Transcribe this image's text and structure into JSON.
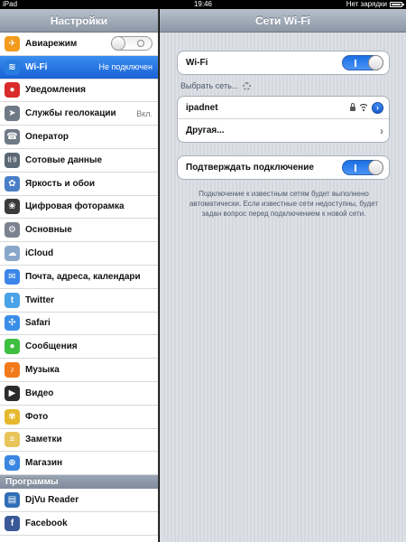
{
  "status": {
    "device": "iPad",
    "time": "19:46",
    "charging": "Нет зарядки",
    "battery_level": 0.85
  },
  "sidebar": {
    "title": "Настройки",
    "items": [
      {
        "label": "Авиарежим",
        "icon": "airplane-icon",
        "color": "#f29b1d",
        "glyph": "✈",
        "value": "",
        "toggle": true
      },
      {
        "label": "Wi-Fi",
        "icon": "wifi-icon",
        "color": "#2a7de0",
        "glyph": "≋",
        "value": "Не подключен",
        "selected": true
      },
      {
        "label": "Уведомления",
        "icon": "notifications-icon",
        "color": "#d92b2b",
        "glyph": "●",
        "value": ""
      },
      {
        "label": "Службы геолокации",
        "icon": "location-icon",
        "color": "#707a86",
        "glyph": "➤",
        "value": "Вкл."
      },
      {
        "label": "Оператор",
        "icon": "carrier-icon",
        "color": "#707a86",
        "glyph": "☎",
        "value": ""
      },
      {
        "label": "Сотовые данные",
        "icon": "cellular-icon",
        "color": "#5c6875",
        "glyph": "((·))",
        "value": ""
      },
      {
        "label": "Яркость и обои",
        "icon": "brightness-icon",
        "color": "#4a7fc7",
        "glyph": "✿",
        "value": ""
      },
      {
        "label": "Цифровая фоторамка",
        "icon": "picture-frame-icon",
        "color": "#3b3b3b",
        "glyph": "❀",
        "value": ""
      },
      {
        "label": "Основные",
        "icon": "gear-icon",
        "color": "#7b8390",
        "glyph": "⚙",
        "value": ""
      },
      {
        "label": "iCloud",
        "icon": "icloud-icon",
        "color": "#8aa6c9",
        "glyph": "☁",
        "value": ""
      },
      {
        "label": "Почта, адреса, календари",
        "icon": "mail-icon",
        "color": "#3b86e8",
        "glyph": "✉",
        "value": ""
      },
      {
        "label": "Twitter",
        "icon": "twitter-icon",
        "color": "#4aa3e6",
        "glyph": "t",
        "value": ""
      },
      {
        "label": "Safari",
        "icon": "safari-icon",
        "color": "#3a8ee8",
        "glyph": "✣",
        "value": ""
      },
      {
        "label": "Сообщения",
        "icon": "messages-icon",
        "color": "#3fbf3f",
        "glyph": "●",
        "value": ""
      },
      {
        "label": "Музыка",
        "icon": "music-icon",
        "color": "#f07a1c",
        "glyph": "♪",
        "value": ""
      },
      {
        "label": "Видео",
        "icon": "video-icon",
        "color": "#2b2b2b",
        "glyph": "▶",
        "value": ""
      },
      {
        "label": "Фото",
        "icon": "photos-icon",
        "color": "#e6b82e",
        "glyph": "✾",
        "value": ""
      },
      {
        "label": "Заметки",
        "icon": "notes-icon",
        "color": "#e8c45a",
        "glyph": "≡",
        "value": ""
      },
      {
        "label": "Магазин",
        "icon": "store-icon",
        "color": "#3a86e0",
        "glyph": "⊕",
        "value": ""
      }
    ],
    "apps_header": "Программы",
    "apps": [
      {
        "label": "DjVu Reader",
        "icon": "djvu-reader-icon",
        "color": "#2f6fb8",
        "glyph": "▤",
        "value": ""
      },
      {
        "label": "Facebook",
        "icon": "facebook-icon",
        "color": "#3b5998",
        "glyph": "f",
        "value": ""
      }
    ]
  },
  "detail": {
    "title": "Сети Wi-Fi",
    "wifi_label": "Wi-Fi",
    "choose_label": "Выбрать сеть...",
    "network_name": "ipadnet",
    "other_label": "Другая...",
    "ask_label": "Подтверждать подключение",
    "note": "Подключение к известным сетям будет выполнено автоматически. Если известные сети недоступны, будет задан вопрос перед подключением к новой сети."
  }
}
